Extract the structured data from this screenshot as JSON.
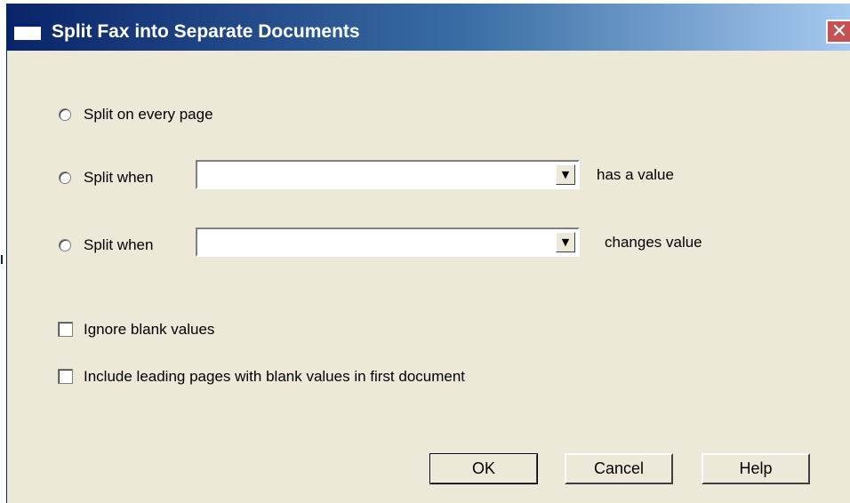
{
  "window": {
    "title": "Split Fax into Separate Documents",
    "close_glyph": "✕",
    "icon": "window-icon"
  },
  "options": {
    "split_every_page_label": "Split on every page",
    "split_when_has_value": {
      "label": "Split when",
      "field_value": "",
      "suffix": "has a value"
    },
    "split_when_changes": {
      "label": "Split when",
      "field_value": "",
      "suffix": "changes value"
    },
    "dropdown_glyph": "▼"
  },
  "checkboxes": {
    "ignore_blank_label": "Ignore blank values",
    "include_leading_label": "Include leading pages with blank values in first document"
  },
  "buttons": {
    "ok": "OK",
    "cancel": "Cancel",
    "help": "Help"
  },
  "colors": {
    "titlebar_start": "#0a246a",
    "titlebar_end": "#a6caf0",
    "dialog_bg": "#ece9d8",
    "close_bg": "#c75050"
  }
}
